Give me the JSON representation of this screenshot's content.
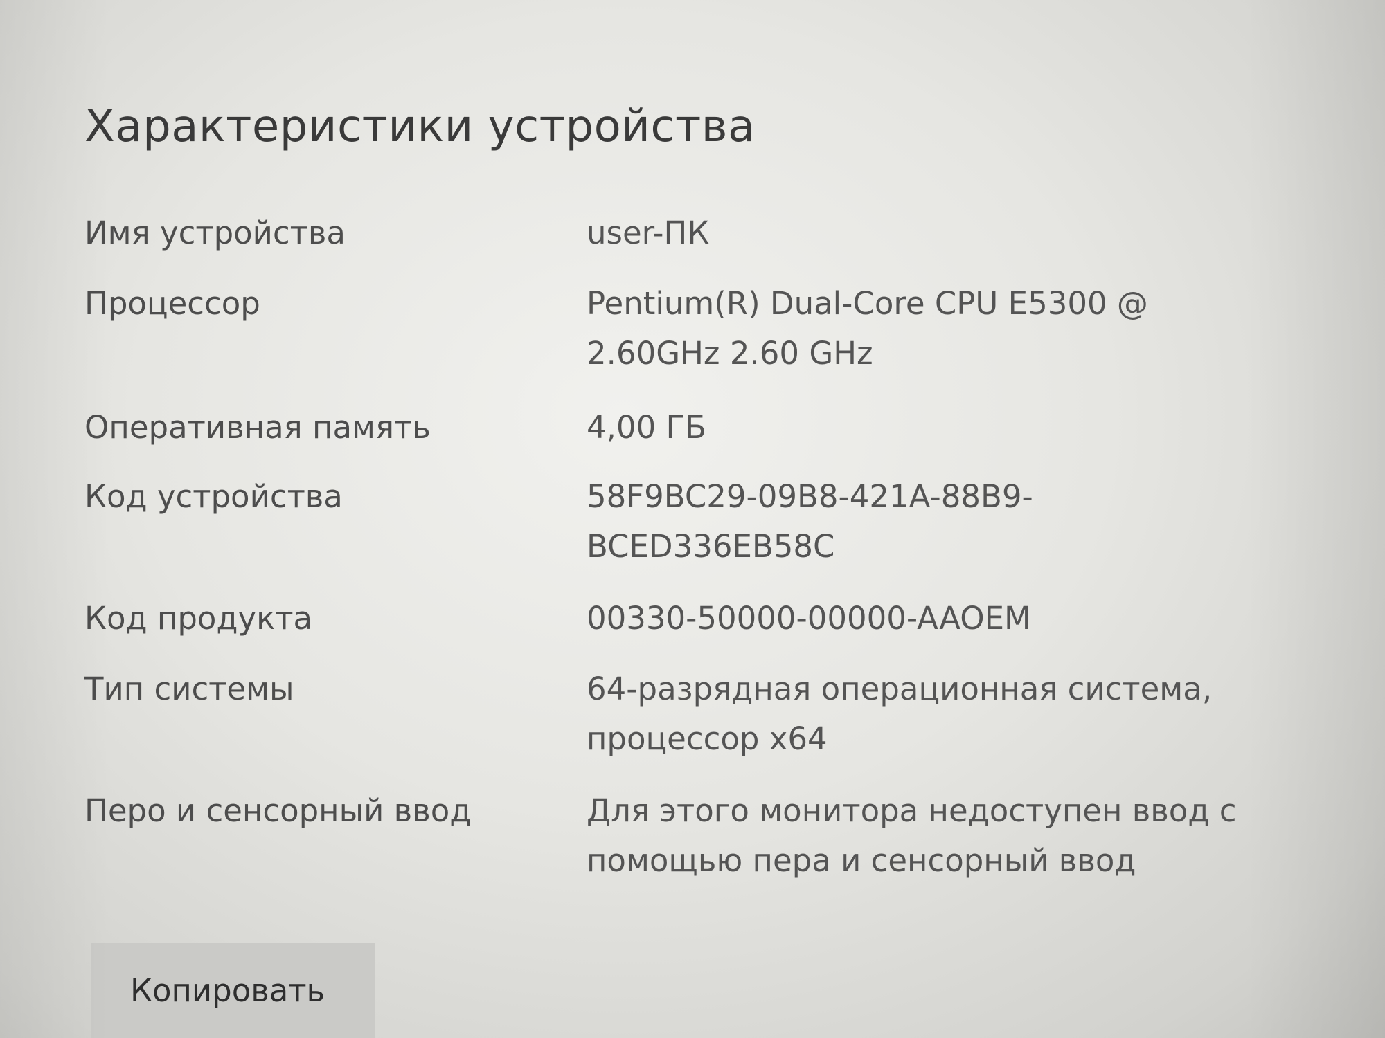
{
  "section": {
    "title": "Характеристики устройства"
  },
  "specs": [
    {
      "label": "Имя устройства",
      "value": "user-ПК"
    },
    {
      "label": "Процессор",
      "value": "Pentium(R) Dual-Core  CPU      E5300  @\n2.60GHz   2.60 GHz"
    },
    {
      "label": "Оперативная память",
      "value": "4,00 ГБ"
    },
    {
      "label": "Код устройства",
      "value": "58F9BC29-09B8-421A-88B9-\nBCED336EB58C"
    },
    {
      "label": "Код продукта",
      "value": "00330-50000-00000-AAOEM"
    },
    {
      "label": "Тип системы",
      "value": "64-разрядная операционная система,\nпроцессор x64"
    },
    {
      "label": "Перо и сенсорный ввод",
      "value": "Для этого монитора недоступен ввод с\nпомощью пера и сенсорный ввод"
    }
  ],
  "actions": {
    "copy_label": "Копировать"
  }
}
